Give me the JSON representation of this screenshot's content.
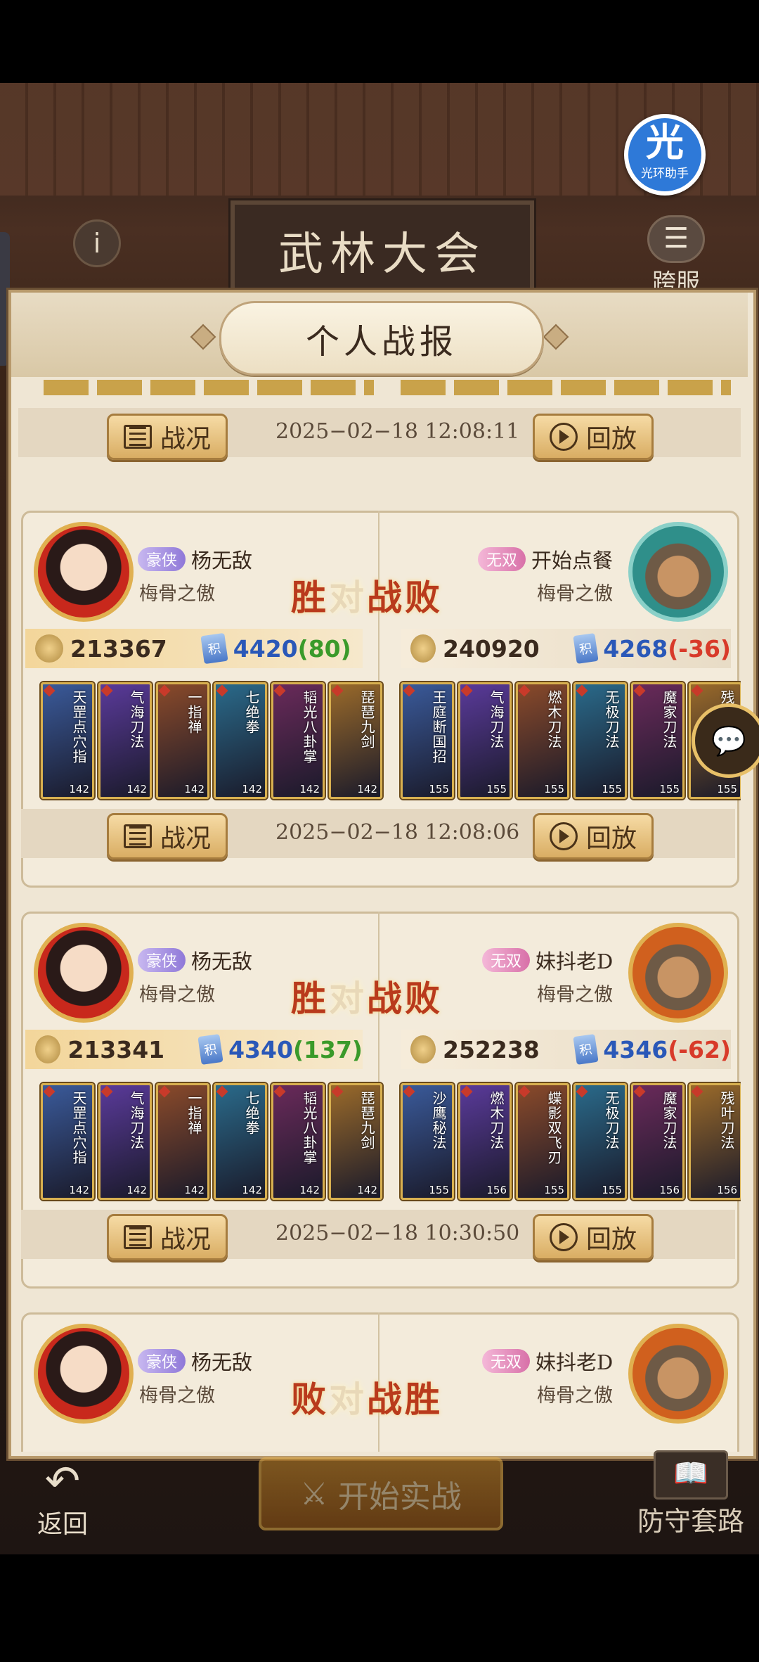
{
  "header": {
    "plaque_title": "武林大会",
    "info_icon": "i",
    "cross_server_label": "跨服",
    "helper_badge_big": "光",
    "helper_badge_small": "光环助手"
  },
  "panel": {
    "title": "个人战报"
  },
  "buttons": {
    "status_label": "战况",
    "replay_label": "回放"
  },
  "top_row": {
    "date": "2025−02−18 12:08:11"
  },
  "matches": [
    {
      "left": {
        "tag": "豪侠",
        "name": "杨无敌",
        "guild": "梅骨之傲",
        "power": "213367",
        "score": "4420",
        "delta": "(80)",
        "heroes": [
          {
            "name": "天罡点穴指",
            "level": "142"
          },
          {
            "name": "气海刀法",
            "level": "142"
          },
          {
            "name": "一指禅",
            "level": "142"
          },
          {
            "name": "七绝拳",
            "level": "142"
          },
          {
            "name": "韬光八卦掌",
            "level": "142"
          },
          {
            "name": "琵琶九剑",
            "level": "142"
          }
        ]
      },
      "right": {
        "tag": "无双",
        "name": "开始点餐",
        "guild": "梅骨之傲",
        "power": "240920",
        "score": "4268",
        "delta": "(-36)",
        "heroes": [
          {
            "name": "王庭断国招",
            "level": "155"
          },
          {
            "name": "气海刀法",
            "level": "155"
          },
          {
            "name": "燃木刀法",
            "level": "155"
          },
          {
            "name": "无极刀法",
            "level": "155"
          },
          {
            "name": "魔家刀法",
            "level": "155"
          },
          {
            "name": "残",
            "level": "155"
          }
        ]
      },
      "result_left": "胜",
      "vs1": "对",
      "vs2": "战",
      "result_right": "败",
      "date": "2025−02−18 12:08:06"
    },
    {
      "left": {
        "tag": "豪侠",
        "name": "杨无敌",
        "guild": "梅骨之傲",
        "power": "213341",
        "score": "4340",
        "delta": "(137)",
        "heroes": [
          {
            "name": "天罡点穴指",
            "level": "142"
          },
          {
            "name": "气海刀法",
            "level": "142"
          },
          {
            "name": "一指禅",
            "level": "142"
          },
          {
            "name": "七绝拳",
            "level": "142"
          },
          {
            "name": "韬光八卦掌",
            "level": "142"
          },
          {
            "name": "琵琶九剑",
            "level": "142"
          }
        ]
      },
      "right": {
        "tag": "无双",
        "name": "妹抖老D",
        "guild": "梅骨之傲",
        "power": "252238",
        "score": "4346",
        "delta": "(-62)",
        "heroes": [
          {
            "name": "沙鹰秘法",
            "level": "155"
          },
          {
            "name": "燃木刀法",
            "level": "156"
          },
          {
            "name": "蝶影双飞刃",
            "level": "155"
          },
          {
            "name": "无极刀法",
            "level": "155"
          },
          {
            "name": "魔家刀法",
            "level": "156"
          },
          {
            "name": "残叶刀法",
            "level": "156"
          }
        ]
      },
      "result_left": "胜",
      "vs1": "对",
      "vs2": "战",
      "result_right": "败",
      "date": "2025−02−18 10:30:50"
    },
    {
      "left": {
        "tag": "豪侠",
        "name": "杨无敌",
        "guild": "梅骨之傲"
      },
      "right": {
        "tag": "无双",
        "name": "妹抖老D",
        "guild": "梅骨之傲"
      },
      "result_left": "败",
      "vs1": "对",
      "vs2": "战",
      "result_right": "胜"
    }
  ],
  "footer": {
    "back_label": "返回",
    "start_label": "开始实战",
    "defense_label": "防守套路"
  },
  "colors": {
    "win": "#b93a1c",
    "panel_bg": "#efe6d4",
    "gold": "#d9ad63",
    "score_blue": "#2a58b8"
  }
}
